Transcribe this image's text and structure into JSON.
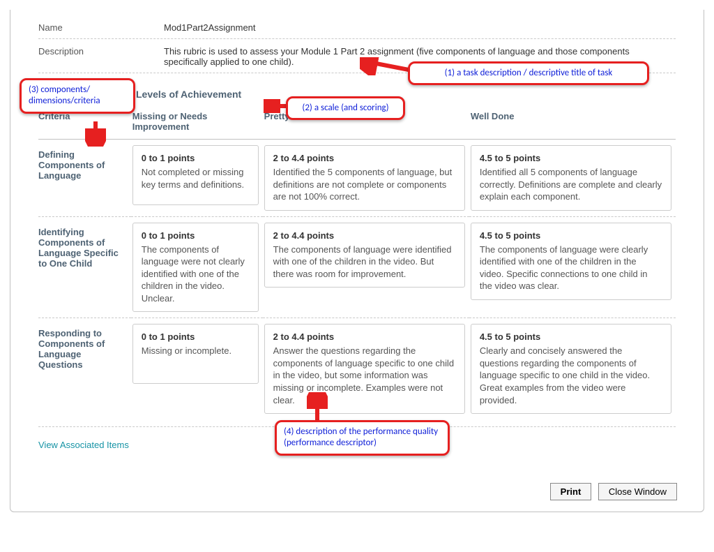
{
  "meta": {
    "name_label": "Name",
    "name_value": "Mod1Part2Assignment",
    "desc_label": "Description",
    "desc_value": "This rubric is used to assess your Module 1 Part 2 assignment (five components of language and those components specifically applied to one child)."
  },
  "section_title": "Levels of Achievement",
  "column_headers": [
    "Criteria",
    "Missing or Needs Improvement",
    "Pretty Good",
    "Well Done"
  ],
  "rows": [
    {
      "criterion": "Defining Components of Language",
      "cells": [
        {
          "points": "0 to 1 points",
          "desc": "Not completed or missing key terms and definitions."
        },
        {
          "points": "2 to 4.4 points",
          "desc": "Identified the 5 components of language, but definitions are not complete or components are not 100% correct."
        },
        {
          "points": "4.5 to 5 points",
          "desc": "Identified all 5 components of language correctly. Definitions are complete and clearly explain each component."
        }
      ]
    },
    {
      "criterion": "Identifying Components of Language Specific to One Child",
      "cells": [
        {
          "points": "0 to 1 points",
          "desc": "The components of language were not clearly identified with one of the children in the video. Unclear."
        },
        {
          "points": "2 to 4.4 points",
          "desc": "The components of language were identified with one of the children in the video. But there was room for improvement."
        },
        {
          "points": "4.5 to 5 points",
          "desc": "The components of language were clearly identified with one of the children in the video. Specific connections to one child in the video was clear."
        }
      ]
    },
    {
      "criterion": "Responding to Components of Language Questions",
      "cells": [
        {
          "points": "0 to 1 points",
          "desc": "Missing or incomplete."
        },
        {
          "points": "2 to 4.4 points",
          "desc": "Answer the questions regarding the components of language specific to one child in the video, but some information was missing or incomplete. Examples were not clear."
        },
        {
          "points": "4.5 to 5 points",
          "desc": "Clearly and concisely answered the questions regarding the components of language specific to one child in the video. Great examples from the video were provided."
        }
      ]
    }
  ],
  "assoc_link": "View Associated Items",
  "buttons": {
    "print": "Print",
    "close": "Close Window"
  },
  "annotations": {
    "a1": "(1) a task description / descriptive title of task",
    "a2": "(2) a scale (and scoring)",
    "a3": "(3) components/ dimensions/criteria",
    "a4": "(4) description of the performance quality (performance descriptor)"
  }
}
